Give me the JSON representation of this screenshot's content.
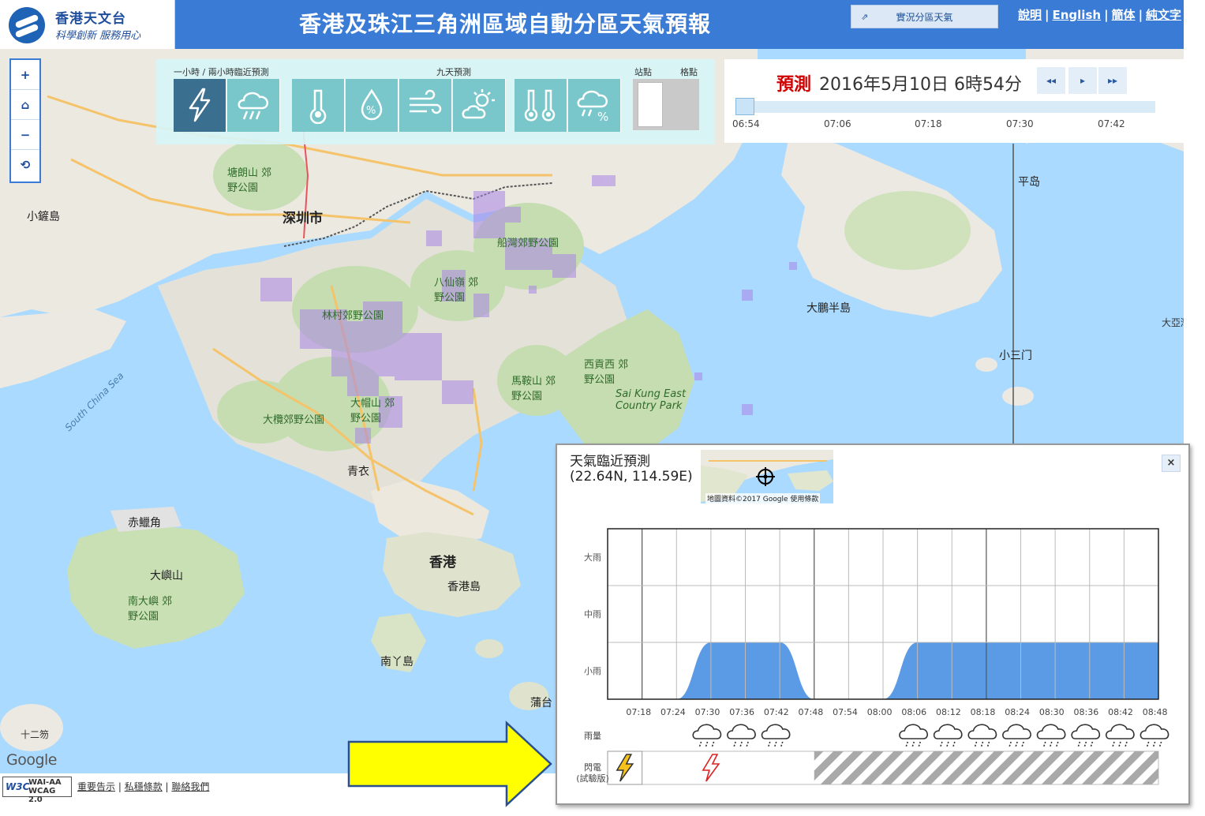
{
  "header": {
    "org_name": "香港天文台",
    "slogan": "科學創新 服務用心",
    "title": "香港及珠江三角洲區域自動分區天氣預報",
    "observation_button": "實況分區天氣",
    "links": [
      "說明",
      "English",
      "簡体",
      "純文字"
    ],
    "brand_color": "#3a7bd5"
  },
  "zoom_controls": [
    "+",
    "⌂",
    "−",
    "⟲"
  ],
  "toolbar": {
    "nowcast_caption": "一小時 / 兩小時臨近預測",
    "nine_day_caption": "九天預測",
    "station_caption": "站點",
    "grid_caption": "格點",
    "buttons": [
      {
        "icon": "lightning-icon",
        "active": true
      },
      {
        "icon": "rain-cloud-icon",
        "active": false
      },
      {
        "icon": "thermometer-icon",
        "active": false
      },
      {
        "icon": "humidity-drop-icon",
        "active": false
      },
      {
        "icon": "wind-icon",
        "active": false
      },
      {
        "icon": "sun-cloud-icon",
        "active": false
      },
      {
        "icon": "max-min-temperature-icon",
        "active": false
      },
      {
        "icon": "rain-probability-icon",
        "active": false
      }
    ]
  },
  "time_panel": {
    "label": "預測",
    "datetime": "2016年5月10日 6時54分",
    "prev_button": "◂◂",
    "play_button": "▸",
    "next_button": "▸▸",
    "ticks": [
      "06:54",
      "07:06",
      "07:18",
      "07:30",
      "07:42"
    ]
  },
  "map_labels": [
    {
      "text": "深圳市",
      "kind": "big"
    },
    {
      "text": "香港",
      "kind": "big"
    },
    {
      "text": "香港島",
      "kind": "mid"
    },
    {
      "text": "大鵬半島",
      "kind": "mid"
    },
    {
      "text": "平岛",
      "kind": "mid"
    },
    {
      "text": "小鏟島",
      "kind": "mid"
    },
    {
      "text": "赤鱲角",
      "kind": "mid"
    },
    {
      "text": "大嶼山",
      "kind": "mid"
    },
    {
      "text": "南丫島",
      "kind": "mid"
    },
    {
      "text": "青衣",
      "kind": "mid"
    },
    {
      "text": "蒲台",
      "kind": "mid"
    },
    {
      "text": "小三门",
      "kind": "mid"
    },
    {
      "text": "塘朗山 郊野公園",
      "kind": "green"
    },
    {
      "text": "林村郊野公園",
      "kind": "green"
    },
    {
      "text": "八仙嶺 郊野公園",
      "kind": "green"
    },
    {
      "text": "船灣郊野公園",
      "kind": "green"
    },
    {
      "text": "大帽山 郊野公園",
      "kind": "green"
    },
    {
      "text": "大欖郊野公園",
      "kind": "green"
    },
    {
      "text": "馬鞍山 郊野公園",
      "kind": "green"
    },
    {
      "text": "西貢西 郊野公園",
      "kind": "green"
    },
    {
      "text": "南大嶼 郊野公園",
      "kind": "green"
    },
    {
      "text": "Sai Kung East Country Park",
      "kind": "green"
    },
    {
      "text": "South China Sea",
      "kind": "sea"
    },
    {
      "text": "大亞灣",
      "kind": "normal"
    },
    {
      "text": "十二笏",
      "kind": "normal"
    }
  ],
  "google_logo": "Google",
  "footer": {
    "w3c": "W3C",
    "wai_line1": "WAI-AA",
    "wai_line2": "WCAG 2.0",
    "links": [
      "重要告示",
      "私穩條款",
      "聯絡我們"
    ]
  },
  "popup": {
    "title_line1": "天氣臨近預測",
    "title_line2": "(22.64N, 114.59E)",
    "close": "×",
    "minimap_attribution": "地圖資料©2017 Google   使用條款",
    "minimap_google": "Google",
    "chart_data": {
      "type": "area",
      "x": [
        "07:18",
        "07:24",
        "07:30",
        "07:36",
        "07:42",
        "07:48",
        "07:54",
        "08:00",
        "08:06",
        "08:12",
        "08:18",
        "08:24",
        "08:30",
        "08:36",
        "08:42",
        "08:48"
      ],
      "y_categories": [
        "小雨",
        "中雨",
        "大雨"
      ],
      "values": [
        0,
        0,
        1,
        1,
        1,
        0,
        0,
        0,
        1,
        1,
        1,
        1,
        1,
        1,
        1,
        1
      ],
      "ylim": [
        0,
        3
      ],
      "fill_color": "#5b9be6",
      "grid": true
    },
    "rain_row": {
      "label": "雨量",
      "rain_icons_at": [
        "07:30",
        "07:36",
        "07:42",
        "08:06",
        "08:12",
        "08:18",
        "08:24",
        "08:30",
        "08:36",
        "08:42",
        "08:48"
      ]
    },
    "lightning_row": {
      "label_line1": "閃電",
      "label_line2": "(試驗版)",
      "lightning_at": "07:30",
      "no_data_after": "07:48"
    }
  }
}
